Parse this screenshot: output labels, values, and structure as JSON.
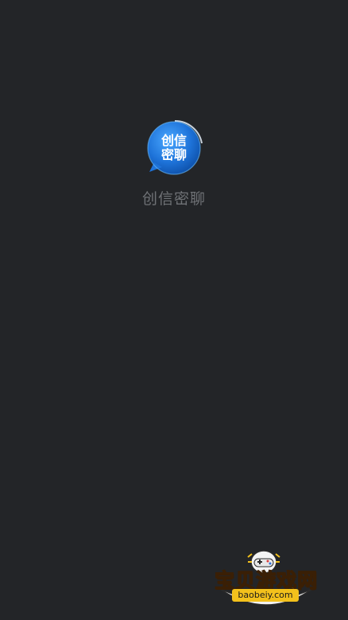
{
  "splash": {
    "logo_text_line1": "创信",
    "logo_text_line2": "密聊",
    "app_name": "创信密聊"
  },
  "watermark": {
    "title": "宝贝游戏网",
    "domain": "baobeiy.com"
  },
  "colors": {
    "background": "#232528",
    "logo_blue": "#1e73d9",
    "app_name_text": "#6f7276",
    "watermark_yellow": "#f7c51a"
  },
  "icons": {
    "logo": "chat-bubble-logo-icon",
    "mascot": "gamepad-mascot-icon"
  }
}
